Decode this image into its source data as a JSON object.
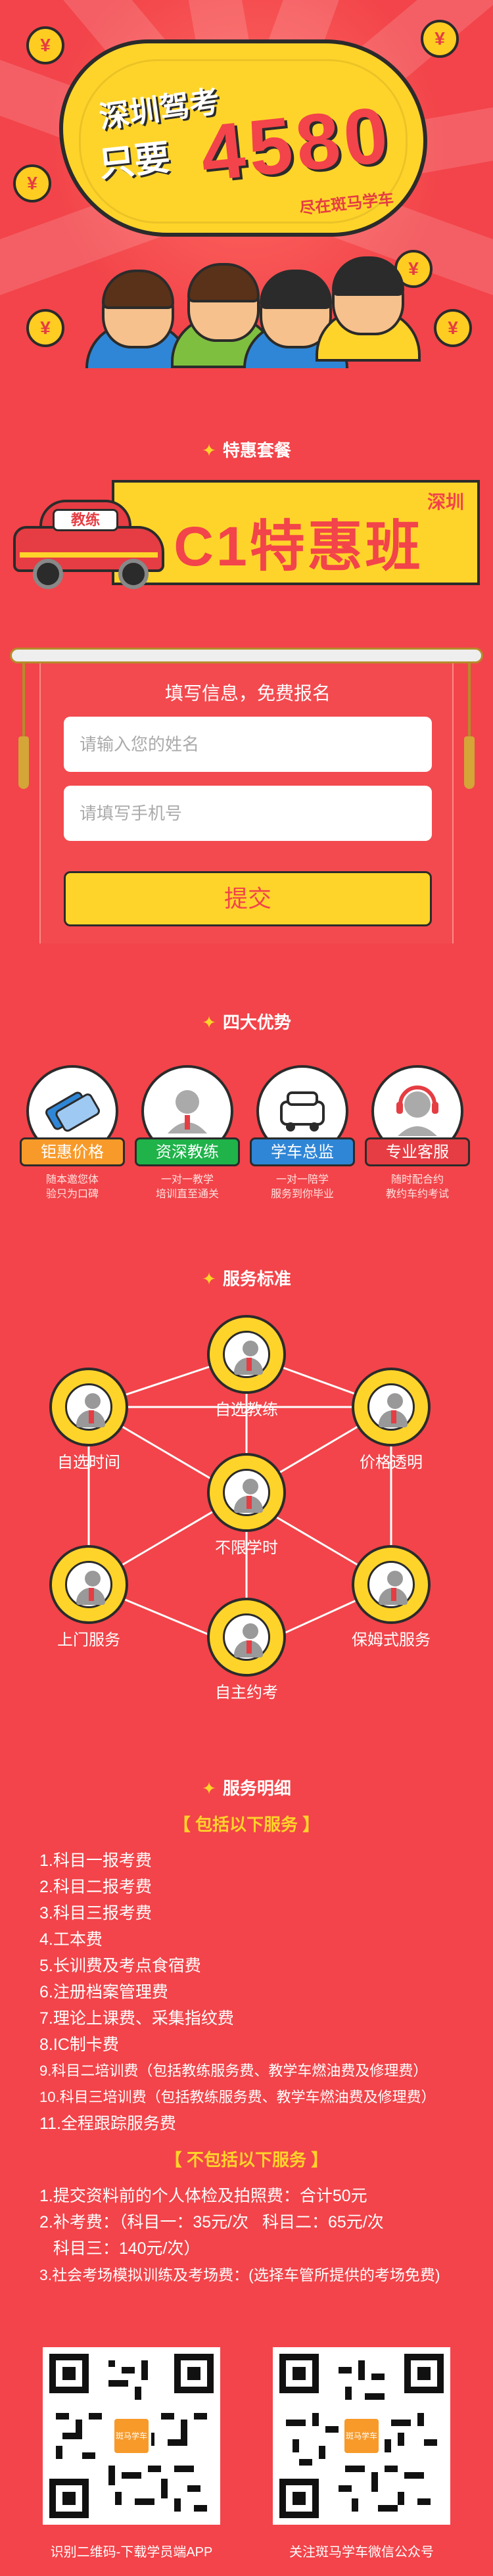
{
  "hero": {
    "line1": "深圳驾考",
    "line2": "只要",
    "price": "4580",
    "sub": "尽在斑马学车",
    "coin_symbol": "¥"
  },
  "package_section": {
    "title": "特惠套餐"
  },
  "banner": {
    "city": "深圳",
    "title": "C1特惠班",
    "car_sign": "教练"
  },
  "form": {
    "title": "填写信息，免费报名",
    "name_placeholder": "请输入您的姓名",
    "phone_placeholder": "请填写手机号",
    "submit_label": "提交"
  },
  "advantages": {
    "title": "四大优势",
    "items": [
      {
        "label": "钜惠价格",
        "color": "#f79a2a",
        "desc1": "随本邀您体",
        "desc2": "验只为口碑",
        "icon": "price-tag-icon"
      },
      {
        "label": "资深教练",
        "color": "#1fb34a",
        "desc1": "一对一教学",
        "desc2": "培训直至通关",
        "icon": "coach-icon"
      },
      {
        "label": "学车总监",
        "color": "#2f86d6",
        "desc1": "一对一陪学",
        "desc2": "服务到你毕业",
        "icon": "car-icon"
      },
      {
        "label": "专业客服",
        "color": "#e53d43",
        "desc1": "随时配合约",
        "desc2": "教约车约考试",
        "icon": "headset-icon"
      }
    ]
  },
  "service_standard": {
    "title": "服务标准",
    "nodes": {
      "top": "自选教练",
      "upper_left": "自选时间",
      "upper_right": "价格透明",
      "center": "不限学时",
      "lower_left": "上门服务",
      "lower_right": "保姆式服务",
      "bottom": "自主约考"
    }
  },
  "service_detail": {
    "title": "服务明细",
    "included_title": "【 包括以下服务 】",
    "included": [
      "1.科目一报考费",
      "2.科目二报考费",
      "3.科目三报考费",
      "4.工本费",
      "5.长训费及考点食宿费",
      "6.注册档案管理费",
      "7.理论上课费、采集指纹费",
      "8.IC制卡费",
      "9.科目二培训费（包括教练服务费、教学车燃油费及修理费）",
      "10.科目三培训费（包括教练服务费、教学车燃油费及修理费）",
      "11.全程跟踪服务费"
    ],
    "excluded_title": "【 不包括以下服务 】",
    "excluded": [
      "1.提交资料前的个人体检及拍照费：合计50元",
      "2.补考费：（科目一：35元/次   科目二：65元/次",
      "   科目三：140元/次）",
      "3.社会考场模拟训练及考场费：(选择车管所提供的考场免费)"
    ]
  },
  "footer": {
    "qr_left_caption": "识别二维码-下载学员端APP",
    "qr_right_caption": "关注斑马学车微信公众号",
    "qr_logo_text": "斑马学车"
  }
}
